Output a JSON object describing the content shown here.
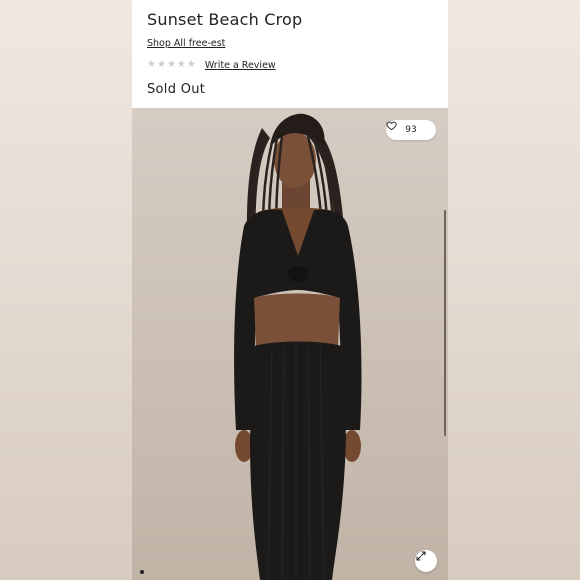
{
  "product": {
    "title": "Sunset Beach Crop",
    "shop_link": "Shop All free-est",
    "rating_stars": 5,
    "rating_filled": 0,
    "review_link": "Write a Review",
    "status": "Sold Out"
  },
  "gallery": {
    "like_count": "93",
    "icons": {
      "like": "heart-icon",
      "expand": "expand-icon"
    },
    "slide_indicator": {
      "current": 1
    }
  },
  "colors": {
    "text": "#222222",
    "star_empty": "#cfcfcf",
    "outfit": "#1c1a19"
  }
}
